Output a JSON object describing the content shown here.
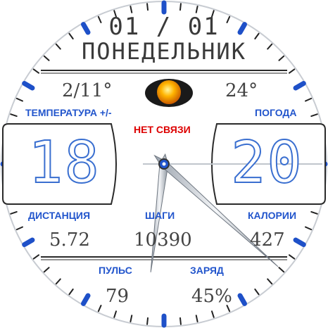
{
  "date": "01 / 01",
  "weekday": "ПОНЕДЕЛЬНИК",
  "temperature": {
    "value": "2/11°",
    "label": "ТЕМПЕРАТУРА +/-"
  },
  "weather": {
    "value": "24°",
    "label": "ПОГОДА",
    "icon": "sun-icon"
  },
  "connection_status": "НЕТ СВЯЗИ",
  "time": {
    "hours": "18",
    "minutes": "20"
  },
  "distance": {
    "label": "ДИСТАНЦИЯ",
    "value": "5.72"
  },
  "steps": {
    "label": "ШАГИ",
    "value": "10390"
  },
  "calories": {
    "label": "КАЛОРИИ",
    "value": "427"
  },
  "pulse": {
    "label": "ПУЛЬС",
    "value": "79"
  },
  "battery": {
    "label": "ЗАРЯД",
    "value": "45%"
  },
  "colors": {
    "accent": "#2255cc",
    "tick": "#1e50c8",
    "text": "#444444",
    "warning": "#dd0000"
  }
}
